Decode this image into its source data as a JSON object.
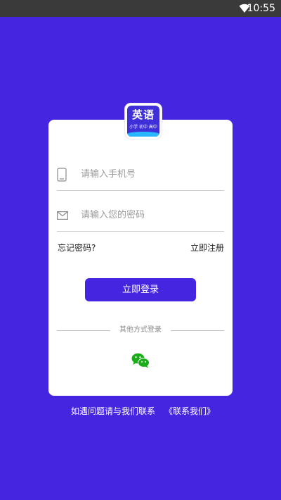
{
  "status_bar": {
    "time": "10:55",
    "icons": [
      "wifi-icon"
    ]
  },
  "app_logo": {
    "title": "英语",
    "subtitle": "小学 初中 高中"
  },
  "login_form": {
    "phone_placeholder": "请输入手机号",
    "password_placeholder": "请输入您的密码",
    "forgot_password": "忘记密码?",
    "register": "立即注册",
    "login_button": "立即登录",
    "other_login": "其他方式登录",
    "other_login_icons": [
      "wechat-icon"
    ]
  },
  "footer": {
    "note": "如遇问题请与我们联系",
    "contact_link": "《联系我们》"
  },
  "colors": {
    "background": "#4525e0",
    "status_bar": "#3a3a3a",
    "card": "#ffffff",
    "button": "#4525e0",
    "wechat": "#1aad19"
  }
}
